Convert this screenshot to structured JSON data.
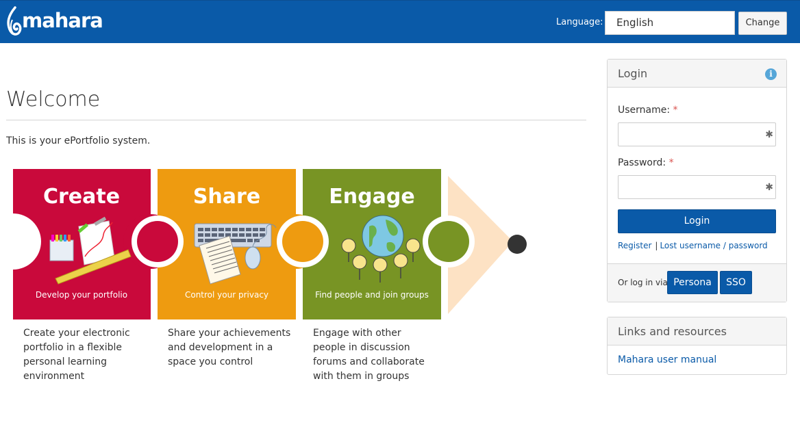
{
  "header": {
    "logo_text": "mahara",
    "language_label": "Language:",
    "language_value": "English",
    "change_label": "Change"
  },
  "main": {
    "title": "Welcome",
    "intro": "This is your ePortfolio system.",
    "pieces": [
      {
        "heading": "Create",
        "caption": "Develop your portfolio",
        "description": "Create your electronic portfolio in a flexible personal learning environment",
        "color": "#c9093b"
      },
      {
        "heading": "Share",
        "caption": "Control your privacy",
        "description": "Share your achievements and development in a space you control",
        "color": "#ee9b10"
      },
      {
        "heading": "Engage",
        "caption": "Find people and join groups",
        "description": "Engage with other people in discussion forums and collaborate with them in groups",
        "color": "#789424"
      }
    ]
  },
  "login": {
    "title": "Login",
    "username_label": "Username:",
    "password_label": "Password:",
    "required_mark": "*",
    "login_button": "Login",
    "register_link": "Register",
    "separator": "|",
    "lost_link": "Lost username / password",
    "alt_label": "Or log in via:",
    "persona_button": "Persona",
    "sso_button": "SSO"
  },
  "resources": {
    "title": "Links and resources",
    "manual_link": "Mahara user manual"
  },
  "colors": {
    "brand": "#0a5aa8",
    "create": "#c9093b",
    "share": "#ee9b10",
    "engage": "#789424",
    "arrow": "#fde2c4"
  }
}
